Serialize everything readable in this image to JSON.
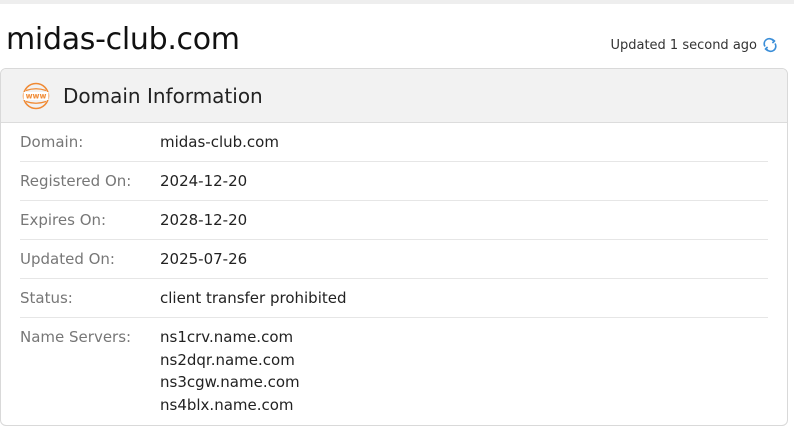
{
  "page": {
    "title": "midas-club.com",
    "updated_text": "Updated 1 second ago"
  },
  "card": {
    "title": "Domain Information",
    "rows": [
      {
        "label": "Domain:",
        "value": "midas-club.com"
      },
      {
        "label": "Registered On:",
        "value": "2024-12-20"
      },
      {
        "label": "Expires On:",
        "value": "2028-12-20"
      },
      {
        "label": "Updated On:",
        "value": "2025-07-26"
      },
      {
        "label": "Status:",
        "value": "client transfer prohibited"
      }
    ],
    "name_servers_label": "Name Servers:",
    "name_servers": [
      "ns1crv.name.com",
      "ns2dqr.name.com",
      "ns3cgw.name.com",
      "ns4blx.name.com"
    ]
  },
  "colors": {
    "accent_orange": "#f08a34",
    "refresh_blue": "#3b8ed8",
    "label_gray": "#777777",
    "header_bg": "#f2f2f2"
  },
  "icons": {
    "header": "www-globe-icon",
    "refresh": "refresh-icon"
  }
}
